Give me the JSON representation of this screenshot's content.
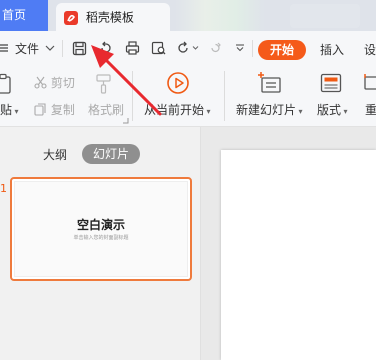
{
  "tabs": {
    "home": "首页",
    "template": "稻壳模板"
  },
  "menu": {
    "file": "文件",
    "start": "开始",
    "insert": "插入",
    "next_tab": "设"
  },
  "ribbon": {
    "paste": "贴",
    "cut": "剪切",
    "copy": "复制",
    "format_painter": "格式刷",
    "play_from_current": "从当前开始",
    "new_slide": "新建幻灯片",
    "layout": "版式",
    "right_edge": "重"
  },
  "panel": {
    "outline_tab": "大纲",
    "slides_tab": "幻灯片",
    "slide_number": "1",
    "thumb_title": "空白演示",
    "thumb_subtitle": "单击输入您的封面副标题"
  },
  "icons": [
    "menu-icon",
    "chevron-down-icon",
    "save-icon",
    "redo-icon",
    "print-icon",
    "preview-icon",
    "undo-icon",
    "dropdown-icon",
    "more-icon",
    "paste-icon",
    "cut-icon",
    "copy-icon",
    "format-painter-icon",
    "play-icon",
    "new-slide-icon",
    "layout-icon"
  ],
  "colors": {
    "accent": "#f55a1a",
    "home_tab": "#4f7cf4",
    "arrow": "#e8292f",
    "selection": "#ef7a3c"
  }
}
